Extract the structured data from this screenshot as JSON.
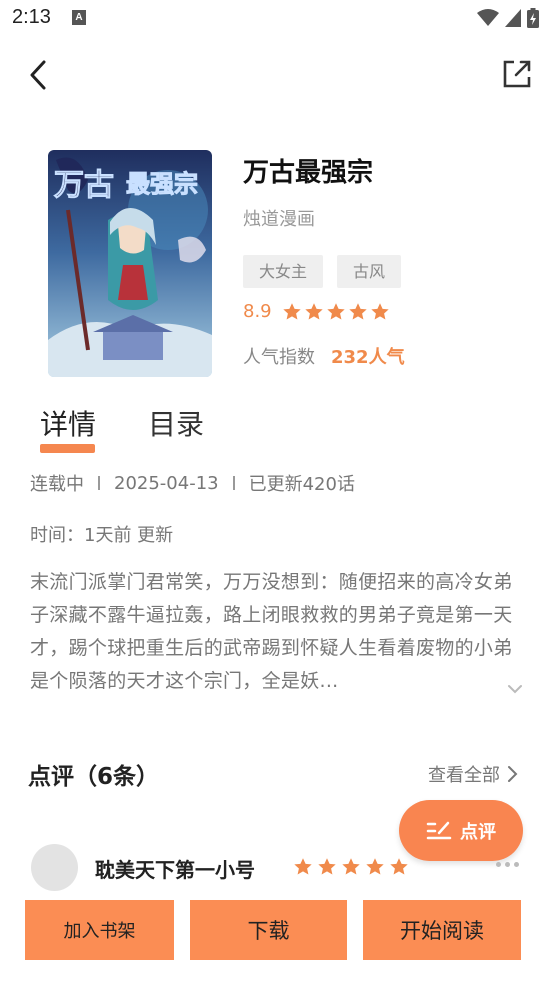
{
  "status_bar": {
    "time": "2:13",
    "notification_icon": "A"
  },
  "nav": {
    "back_icon": "chevron-left-icon",
    "share_icon": "share-icon"
  },
  "book": {
    "title": "万古最强宗",
    "author": "烛道漫画",
    "tags": [
      "大女主",
      "古风"
    ],
    "rating": "8.9",
    "rating_stars": 5,
    "popularity_label": "人气指数",
    "popularity_value": "232人气"
  },
  "tabs": [
    {
      "label": "详情",
      "active": true
    },
    {
      "label": "目录",
      "active": false
    }
  ],
  "details": {
    "status": "连载中",
    "date": "2025-04-13",
    "chapters": "已更新420话",
    "update_time": "时间：1天前 更新",
    "synopsis": "末流门派掌门君常笑，万万没想到：随便招来的高冷女弟子深藏不露牛逼拉轰，路上闭眼救救的男弟子竟是第一天才，踢个球把重生后的武帝踢到怀疑人生看着废物的小弟是个陨落的天才这个宗门，全是妖..."
  },
  "reviews": {
    "title": "点评（6条）",
    "view_all": "查看全部",
    "fab_label": "点评",
    "items": [
      {
        "user": "耽美天下第一小号",
        "stars": 5
      }
    ]
  },
  "actions": {
    "add_shelf": "加入书架",
    "download": "下载",
    "start_reading": "开始阅读"
  },
  "colors": {
    "accent": "#f98550",
    "star": "#f08a4b"
  }
}
